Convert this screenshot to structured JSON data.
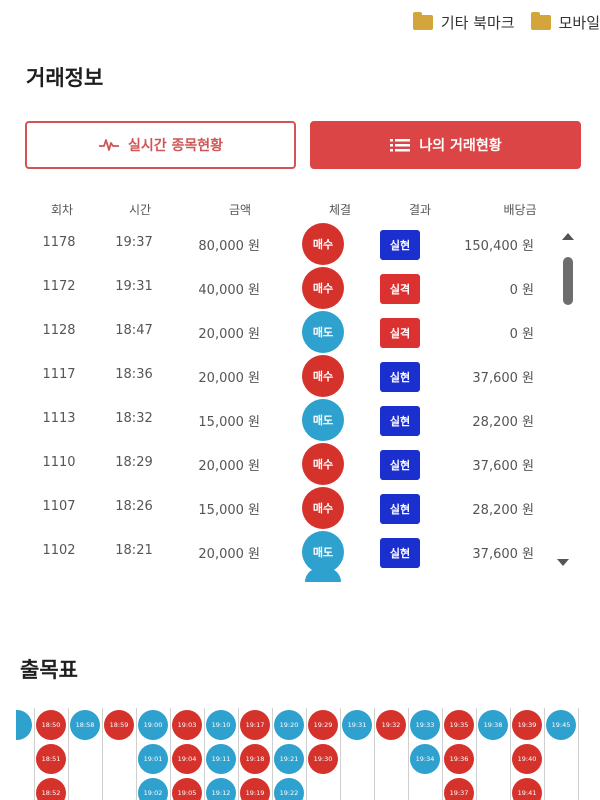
{
  "bookmarks": [
    {
      "label": "기타 북마크",
      "icon": "folder-icon"
    },
    {
      "label": "모바일",
      "icon": "folder-icon"
    }
  ],
  "titles": {
    "trade": "거래정보",
    "board": "출목표"
  },
  "tabs": [
    {
      "label": "실시간 종목현황",
      "icon": "pulse-icon",
      "active": false
    },
    {
      "label": "나의 거래현황",
      "icon": "list-icon",
      "active": true
    }
  ],
  "table": {
    "headers": [
      "회차",
      "시간",
      "금액",
      "체결",
      "결과",
      "배당금"
    ],
    "rows": [
      {
        "round": "1178",
        "time": "19:37",
        "amount": "80,000 원",
        "deal": "매수",
        "result": "실현",
        "payout": "150,400 원"
      },
      {
        "round": "1172",
        "time": "19:31",
        "amount": "40,000 원",
        "deal": "매수",
        "result": "실격",
        "payout": "0 원"
      },
      {
        "round": "1128",
        "time": "18:47",
        "amount": "20,000 원",
        "deal": "매도",
        "result": "실격",
        "payout": "0 원"
      },
      {
        "round": "1117",
        "time": "18:36",
        "amount": "20,000 원",
        "deal": "매수",
        "result": "실현",
        "payout": "37,600 원"
      },
      {
        "round": "1113",
        "time": "18:32",
        "amount": "15,000 원",
        "deal": "매도",
        "result": "실현",
        "payout": "28,200 원"
      },
      {
        "round": "1110",
        "time": "18:29",
        "amount": "20,000 원",
        "deal": "매수",
        "result": "실현",
        "payout": "37,600 원"
      },
      {
        "round": "1107",
        "time": "18:26",
        "amount": "15,000 원",
        "deal": "매수",
        "result": "실현",
        "payout": "28,200 원"
      },
      {
        "round": "1102",
        "time": "18:21",
        "amount": "20,000 원",
        "deal": "매도",
        "result": "실현",
        "payout": "37,600 원"
      }
    ]
  },
  "colors": {
    "buy": "#d6322c",
    "sell": "#2ea1cf",
    "win": "#1b2fcf",
    "lose": "#dc3131",
    "accent": "#dc4545"
  },
  "board": {
    "columns": [
      {
        "dots": [
          {
            "c": "b",
            "t": ""
          }
        ]
      },
      {
        "dots": [
          {
            "c": "r",
            "t": "18:50"
          },
          {
            "c": "r",
            "t": "18:51"
          },
          {
            "c": "r",
            "t": "18:52"
          }
        ]
      },
      {
        "dots": [
          {
            "c": "b",
            "t": "18:58"
          }
        ]
      },
      {
        "dots": [
          {
            "c": "r",
            "t": "18:59"
          }
        ]
      },
      {
        "dots": [
          {
            "c": "b",
            "t": "19:00"
          },
          {
            "c": "b",
            "t": "19:01"
          },
          {
            "c": "b",
            "t": "19:02"
          }
        ]
      },
      {
        "dots": [
          {
            "c": "r",
            "t": "19:03"
          },
          {
            "c": "r",
            "t": "19:04"
          },
          {
            "c": "r",
            "t": "19:05"
          }
        ]
      },
      {
        "dots": [
          {
            "c": "b",
            "t": "19:10"
          },
          {
            "c": "b",
            "t": "19:11"
          },
          {
            "c": "b",
            "t": "19:12"
          }
        ]
      },
      {
        "dots": [
          {
            "c": "r",
            "t": "19:17"
          },
          {
            "c": "r",
            "t": "19:18"
          },
          {
            "c": "r",
            "t": "19:19"
          }
        ]
      },
      {
        "dots": [
          {
            "c": "b",
            "t": "19:20"
          },
          {
            "c": "b",
            "t": "19:21"
          },
          {
            "c": "b",
            "t": "19:22"
          }
        ]
      },
      {
        "dots": [
          {
            "c": "r",
            "t": "19:29"
          },
          {
            "c": "r",
            "t": "19:30"
          }
        ]
      },
      {
        "dots": [
          {
            "c": "b",
            "t": "19:31"
          }
        ]
      },
      {
        "dots": [
          {
            "c": "r",
            "t": "19:32"
          }
        ]
      },
      {
        "dots": [
          {
            "c": "b",
            "t": "19:33"
          },
          {
            "c": "b",
            "t": "19:34"
          }
        ]
      },
      {
        "dots": [
          {
            "c": "r",
            "t": "19:35"
          },
          {
            "c": "r",
            "t": "19:36"
          },
          {
            "c": "r",
            "t": "19:37"
          }
        ]
      },
      {
        "dots": [
          {
            "c": "b",
            "t": "19:38"
          }
        ]
      },
      {
        "dots": [
          {
            "c": "r",
            "t": "19:39"
          },
          {
            "c": "r",
            "t": "19:40"
          },
          {
            "c": "r",
            "t": "19:41"
          }
        ]
      },
      {
        "dots": [
          {
            "c": "b",
            "t": "19:45"
          }
        ]
      }
    ]
  }
}
